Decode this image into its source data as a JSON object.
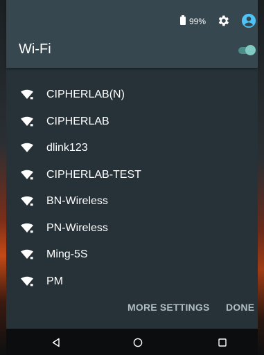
{
  "status_bar": {
    "battery_text": "99%",
    "icons": [
      "battery-icon",
      "gear-icon",
      "account-icon"
    ]
  },
  "header": {
    "title": "Wi-Fi",
    "toggle_state": "on"
  },
  "networks": [
    {
      "name": "CIPHERLAB(N)",
      "secured": true
    },
    {
      "name": "CIPHERLAB",
      "secured": true
    },
    {
      "name": "dlink123",
      "secured": false
    },
    {
      "name": "CIPHERLAB-TEST",
      "secured": true
    },
    {
      "name": "BN-Wireless",
      "secured": true
    },
    {
      "name": "PN-Wireless",
      "secured": true
    },
    {
      "name": "Ming-5S",
      "secured": true
    },
    {
      "name": "PM",
      "secured": true
    }
  ],
  "actions": {
    "more_settings": "MORE SETTINGS",
    "done": "DONE"
  },
  "nav_bar": {
    "icons": [
      "back-icon",
      "home-icon",
      "recents-icon"
    ]
  },
  "colors": {
    "panel_bg": "#263238",
    "header_bg": "#37474f",
    "accent": "#80cbc4",
    "account": "#4fc3f7"
  }
}
